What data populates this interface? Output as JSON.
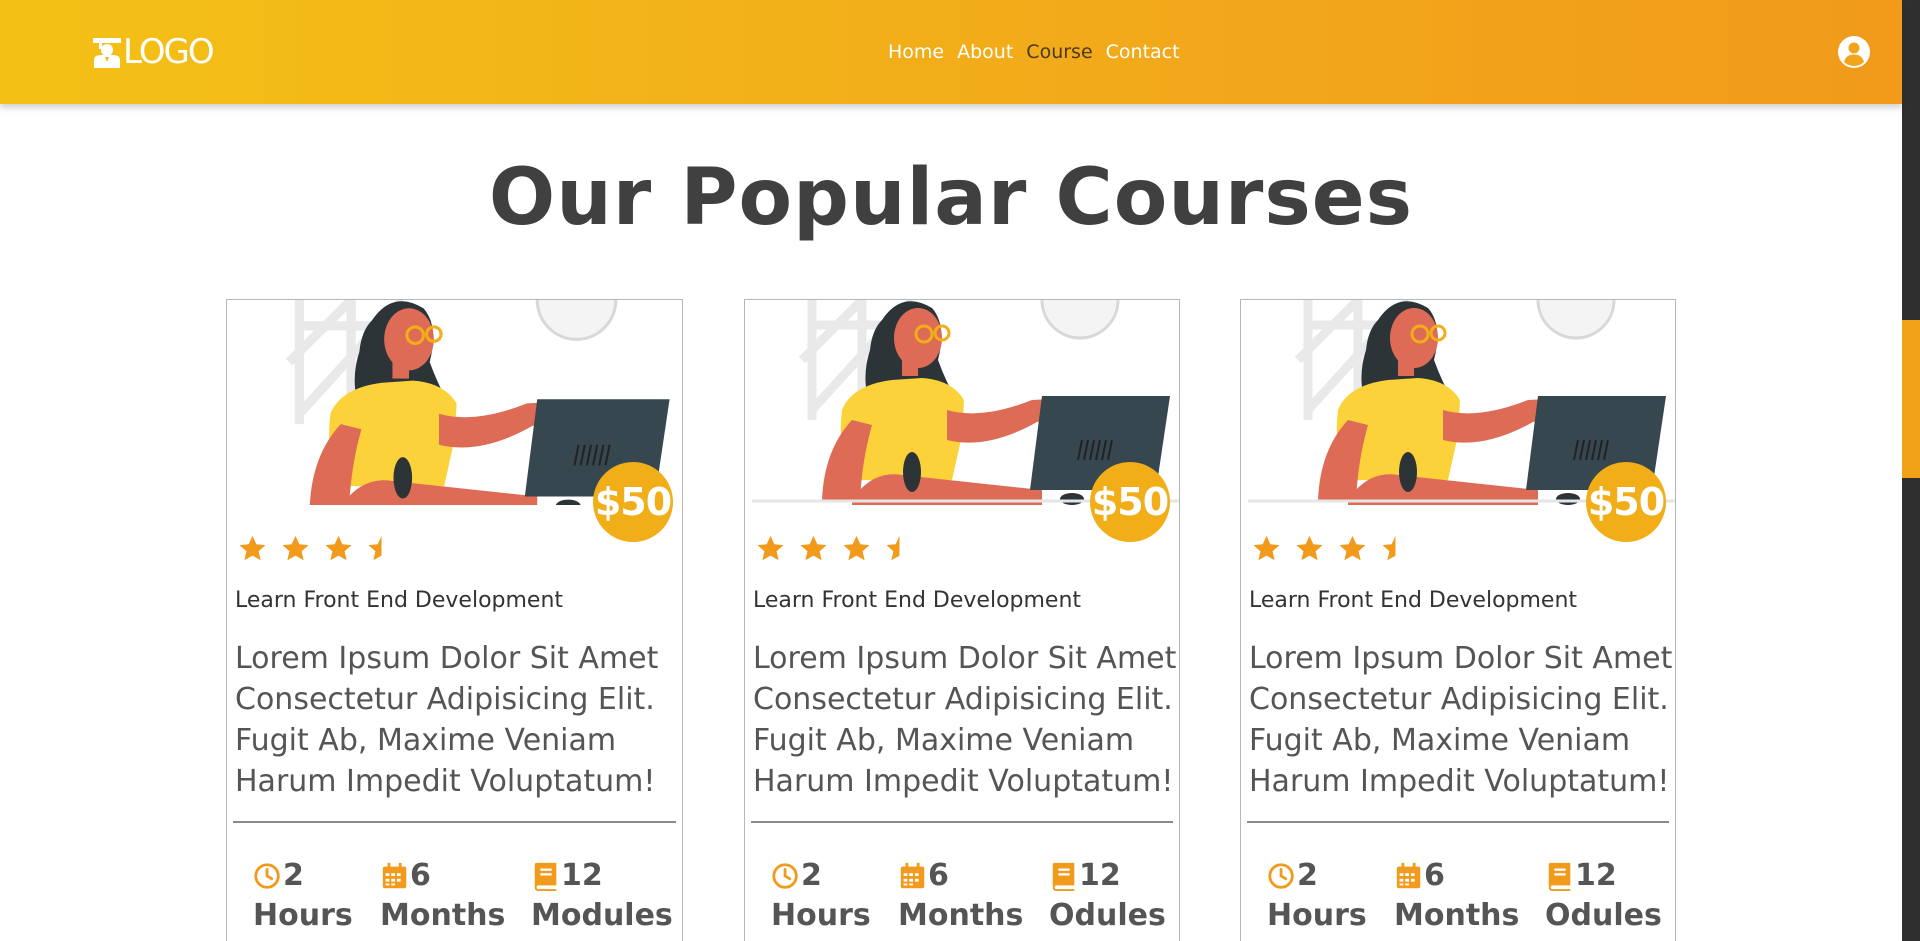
{
  "header": {
    "logo_text": "LOGO",
    "nav": [
      "Home",
      "About",
      "Course",
      "Contact"
    ],
    "active_nav": "Course"
  },
  "page_title": "Our Popular Courses",
  "colors": {
    "accent": "#f2ae18",
    "header_start": "#f3c116",
    "header_end": "#f19a1b",
    "text": "#404040"
  },
  "courses": [
    {
      "price": "$50",
      "rating": 3.5,
      "name": "Learn Front End Development",
      "description": "Lorem Ipsum Dolor Sit Amet Consectetur Adipisicing Elit. Fugit Ab, Maxime Veniam Harum Impedit Voluptatum!",
      "stats": [
        {
          "icon": "clock-icon",
          "value": "2",
          "label": "Hours"
        },
        {
          "icon": "calendar-icon",
          "value": "6",
          "label": "Months"
        },
        {
          "icon": "book-icon",
          "value": "12",
          "label": "Modules"
        }
      ]
    },
    {
      "price": "$50",
      "rating": 3.5,
      "name": "Learn Front End Development",
      "description": "Lorem Ipsum Dolor Sit Amet Consectetur Adipisicing Elit. Fugit Ab, Maxime Veniam Harum Impedit Voluptatum!",
      "stats": [
        {
          "icon": "clock-icon",
          "value": "2",
          "label": "Hours"
        },
        {
          "icon": "calendar-icon",
          "value": "6",
          "label": "Months"
        },
        {
          "icon": "book-icon",
          "value": "12",
          "label": "Odules"
        }
      ]
    },
    {
      "price": "$50",
      "rating": 3.5,
      "name": "Learn Front End Development",
      "description": "Lorem Ipsum Dolor Sit Amet Consectetur Adipisicing Elit. Fugit Ab, Maxime Veniam Harum Impedit Voluptatum!",
      "stats": [
        {
          "icon": "clock-icon",
          "value": "2",
          "label": "Hours"
        },
        {
          "icon": "calendar-icon",
          "value": "6",
          "label": "Months"
        },
        {
          "icon": "book-icon",
          "value": "12",
          "label": "Odules"
        }
      ]
    }
  ]
}
